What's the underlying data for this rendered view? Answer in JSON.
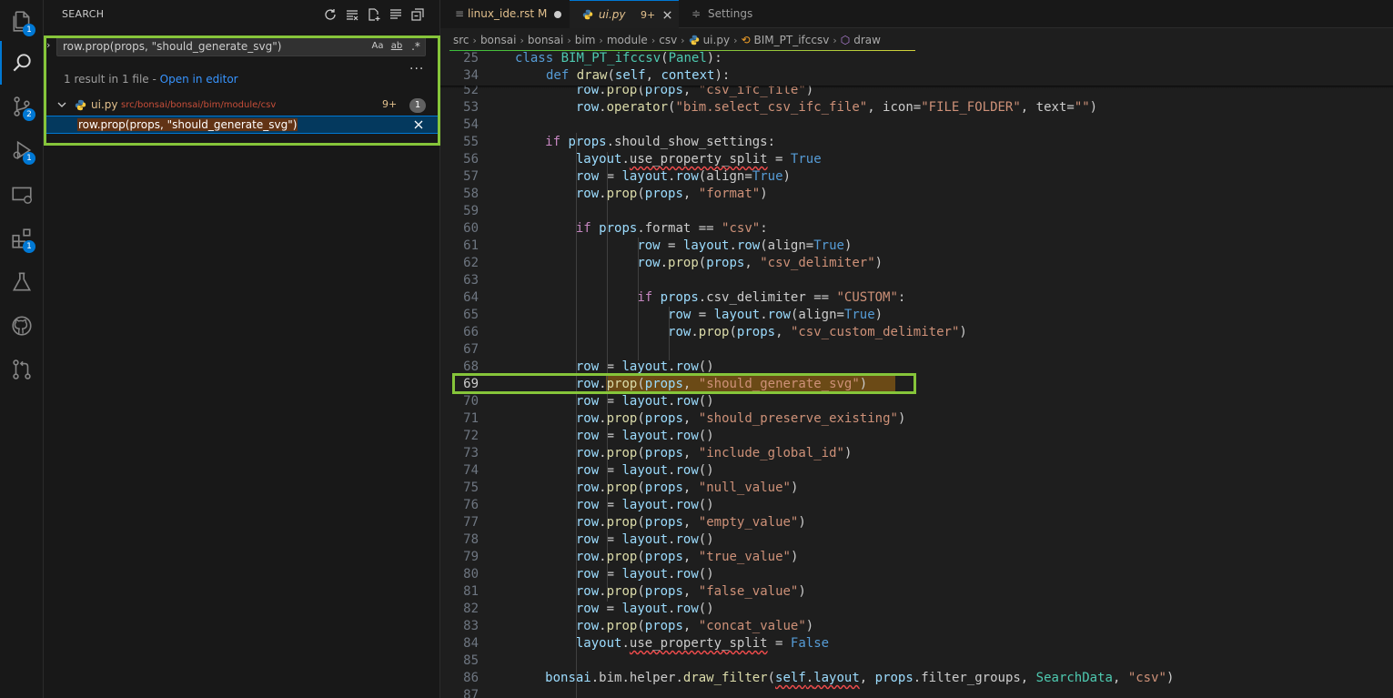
{
  "activity_bar": {
    "items": [
      {
        "name": "explorer",
        "badge": "1"
      },
      {
        "name": "search",
        "badge": ""
      },
      {
        "name": "source-control",
        "badge": "2"
      },
      {
        "name": "run-debug",
        "badge": "1"
      },
      {
        "name": "remote-explorer",
        "badge": ""
      },
      {
        "name": "extensions",
        "badge": "1"
      },
      {
        "name": "testing",
        "badge": ""
      },
      {
        "name": "github",
        "badge": ""
      },
      {
        "name": "pull-requests",
        "badge": ""
      }
    ]
  },
  "sidebar": {
    "title": "SEARCH",
    "search": {
      "value": "row.prop(props, \"should_generate_svg\")",
      "match_case": "Aa",
      "whole_word": "ab",
      "regex": ".*"
    },
    "more": "...",
    "summary": "1 result in 1 file - ",
    "open_in_editor": "Open in editor",
    "file": {
      "name": "ui.py",
      "path": "src/bonsai/bonsai/bim/module/csv",
      "problems": "9+",
      "count": "1"
    },
    "match": "row.prop(props, \"should_generate_svg\")"
  },
  "tabs": [
    {
      "label": "linux_ide.rst",
      "status": "M"
    },
    {
      "label": "ui.py",
      "status": "9+"
    },
    {
      "label": "Settings",
      "status": ""
    }
  ],
  "breadcrumb": [
    "src",
    "bonsai",
    "bonsai",
    "bim",
    "module",
    "csv",
    "ui.py",
    "BIM_PT_ifccsv",
    "draw"
  ],
  "editor": {
    "current_line": "69",
    "sticky": [
      {
        "n": "25",
        "text": "class BIM_PT_ifccsv(Panel):"
      },
      {
        "n": "34",
        "text": "def draw(self, context):"
      }
    ],
    "lines": [
      {
        "n": "52",
        "text": "row.prop(props, \"csv_ifc_file\")"
      },
      {
        "n": "53",
        "text": "row.operator(\"bim.select_csv_ifc_file\", icon=\"FILE_FOLDER\", text=\"\")"
      },
      {
        "n": "54",
        "text": ""
      },
      {
        "n": "55",
        "text": "if props.should_show_settings:"
      },
      {
        "n": "56",
        "text": "layout.use_property_split = True"
      },
      {
        "n": "57",
        "text": "row = layout.row(align=True)"
      },
      {
        "n": "58",
        "text": "row.prop(props, \"format\")"
      },
      {
        "n": "59",
        "text": ""
      },
      {
        "n": "60",
        "text": "if props.format == \"csv\":"
      },
      {
        "n": "61",
        "text": "row = layout.row(align=True)"
      },
      {
        "n": "62",
        "text": "row.prop(props, \"csv_delimiter\")"
      },
      {
        "n": "63",
        "text": ""
      },
      {
        "n": "64",
        "text": "if props.csv_delimiter == \"CUSTOM\":"
      },
      {
        "n": "65",
        "text": "row = layout.row(align=True)"
      },
      {
        "n": "66",
        "text": "row.prop(props, \"csv_custom_delimiter\")"
      },
      {
        "n": "67",
        "text": ""
      },
      {
        "n": "68",
        "text": "row = layout.row()"
      },
      {
        "n": "69",
        "text": "row.prop(props, \"should_generate_svg\")"
      },
      {
        "n": "70",
        "text": "row = layout.row()"
      },
      {
        "n": "71",
        "text": "row.prop(props, \"should_preserve_existing\")"
      },
      {
        "n": "72",
        "text": "row = layout.row()"
      },
      {
        "n": "73",
        "text": "row.prop(props, \"include_global_id\")"
      },
      {
        "n": "74",
        "text": "row = layout.row()"
      },
      {
        "n": "75",
        "text": "row.prop(props, \"null_value\")"
      },
      {
        "n": "76",
        "text": "row = layout.row()"
      },
      {
        "n": "77",
        "text": "row.prop(props, \"empty_value\")"
      },
      {
        "n": "78",
        "text": "row = layout.row()"
      },
      {
        "n": "79",
        "text": "row.prop(props, \"true_value\")"
      },
      {
        "n": "80",
        "text": "row = layout.row()"
      },
      {
        "n": "81",
        "text": "row.prop(props, \"false_value\")"
      },
      {
        "n": "82",
        "text": "row = layout.row()"
      },
      {
        "n": "83",
        "text": "row.prop(props, \"concat_value\")"
      },
      {
        "n": "84",
        "text": "layout.use_property_split = False"
      },
      {
        "n": "85",
        "text": ""
      },
      {
        "n": "86",
        "text": "bonsai.bim.helper.draw_filter(self.layout, props.filter_groups, SearchData, \"csv\")"
      },
      {
        "n": "87",
        "text": ""
      }
    ]
  },
  "colors": {
    "accent": "#0078d4",
    "annotation": "#86c53a",
    "match_highlight": "#6b4a16"
  }
}
